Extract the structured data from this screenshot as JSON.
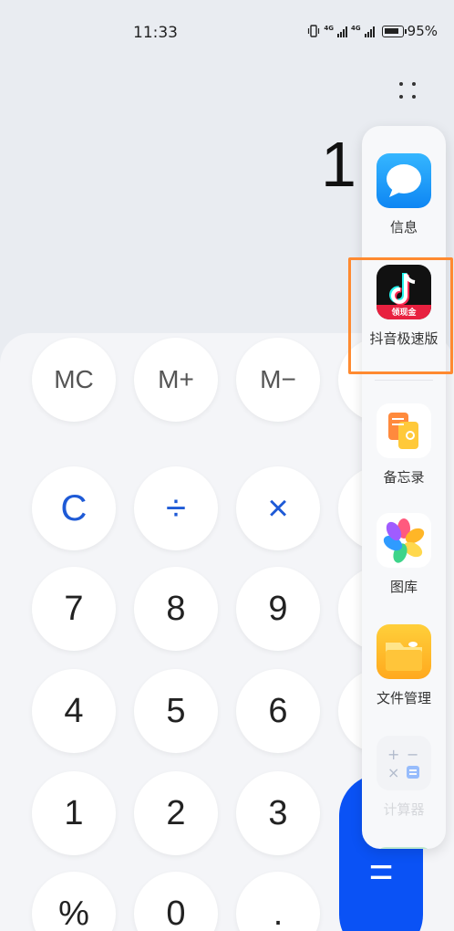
{
  "status_bar": {
    "time": "11:33",
    "battery_percent": "95%",
    "net_1": "4G",
    "net_2": "4G"
  },
  "display": {
    "value": "1"
  },
  "keypad": {
    "rows": [
      [
        "MC",
        "M+",
        "M−"
      ],
      [
        "C",
        "÷",
        "×"
      ],
      [
        "7",
        "8",
        "9"
      ],
      [
        "4",
        "5",
        "6"
      ],
      [
        "1",
        "2",
        "3"
      ],
      [
        "%",
        "0",
        "."
      ]
    ],
    "equals": "="
  },
  "dock": {
    "apps": [
      {
        "label": "信息",
        "icon": "messages-icon"
      },
      {
        "label": "抖音极速版",
        "icon": "douyin-lite-icon",
        "badge": "领现金"
      },
      {
        "label": "备忘录",
        "icon": "notes-icon"
      },
      {
        "label": "图库",
        "icon": "gallery-icon"
      },
      {
        "label": "文件管理",
        "icon": "files-icon"
      },
      {
        "label": "计算器",
        "icon": "calculator-icon"
      }
    ]
  },
  "colors": {
    "accent": "#1e5ad6",
    "equals_bg": "#0a52f5",
    "highlight": "#ff8a30",
    "background": "#e9ecf1"
  }
}
